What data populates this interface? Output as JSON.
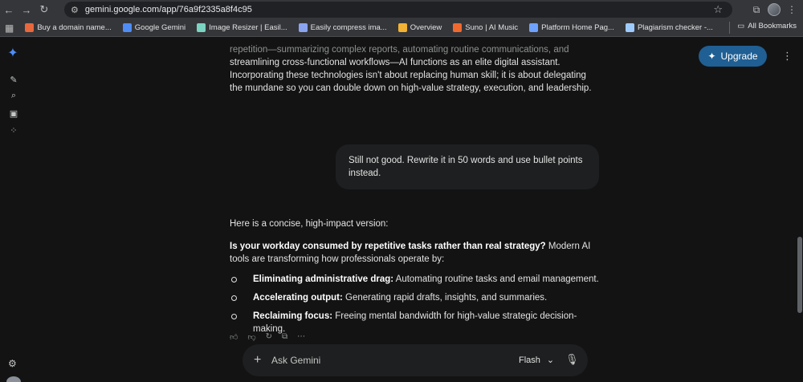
{
  "browser": {
    "url": "gemini.google.com/app/76a9f2335a8f4c95",
    "all_bookmarks": "All Bookmarks",
    "bookmarks": [
      {
        "label": "Buy a domain name...",
        "color": "#e8673b"
      },
      {
        "label": "Google Gemini",
        "color": "#4f8df5"
      },
      {
        "label": "Image Resizer | Easil...",
        "color": "#7bd3c2"
      },
      {
        "label": "Easily compress ima...",
        "color": "#8aa4f0"
      },
      {
        "label": "Overview",
        "color": "#f2b233"
      },
      {
        "label": "Suno | AI Music",
        "color": "#f06a2e"
      },
      {
        "label": "Platform Home Pag...",
        "color": "#6fa2ff"
      },
      {
        "label": "Plagiarism checker -...",
        "color": "#9ecbff"
      }
    ]
  },
  "header": {
    "upgrade_label": "Upgrade"
  },
  "conversation": {
    "prev_faded": "repetition—summarizing complex reports, automating routine communications, and",
    "prev_text": "streamlining cross-functional workflows—AI functions as an elite digital assistant. Incorporating these technologies isn't about replacing human skill; it is about delegating the mundane so you can double down on high-value strategy, execution, and leadership.",
    "user_message": "Still not good. Rewrite it in 50 words and use bullet points instead.",
    "intro": "Here is a concise, high-impact version:",
    "lead_bold": "Is your workday consumed by repetitive tasks rather than real strategy?",
    "lead_rest": " Modern AI tools are transforming how professionals operate by:",
    "bullets": [
      {
        "bold": "Eliminating administrative drag:",
        "text": " Automating routine tasks and email management."
      },
      {
        "bold": "Accelerating output:",
        "text": " Generating rapid drafts, insights, and summaries."
      },
      {
        "bold": "Reclaiming focus:",
        "text": " Freeing mental bandwidth for high-value strategic decision-making."
      }
    ]
  },
  "input": {
    "placeholder": "Ask Gemini",
    "model": "Flash"
  }
}
